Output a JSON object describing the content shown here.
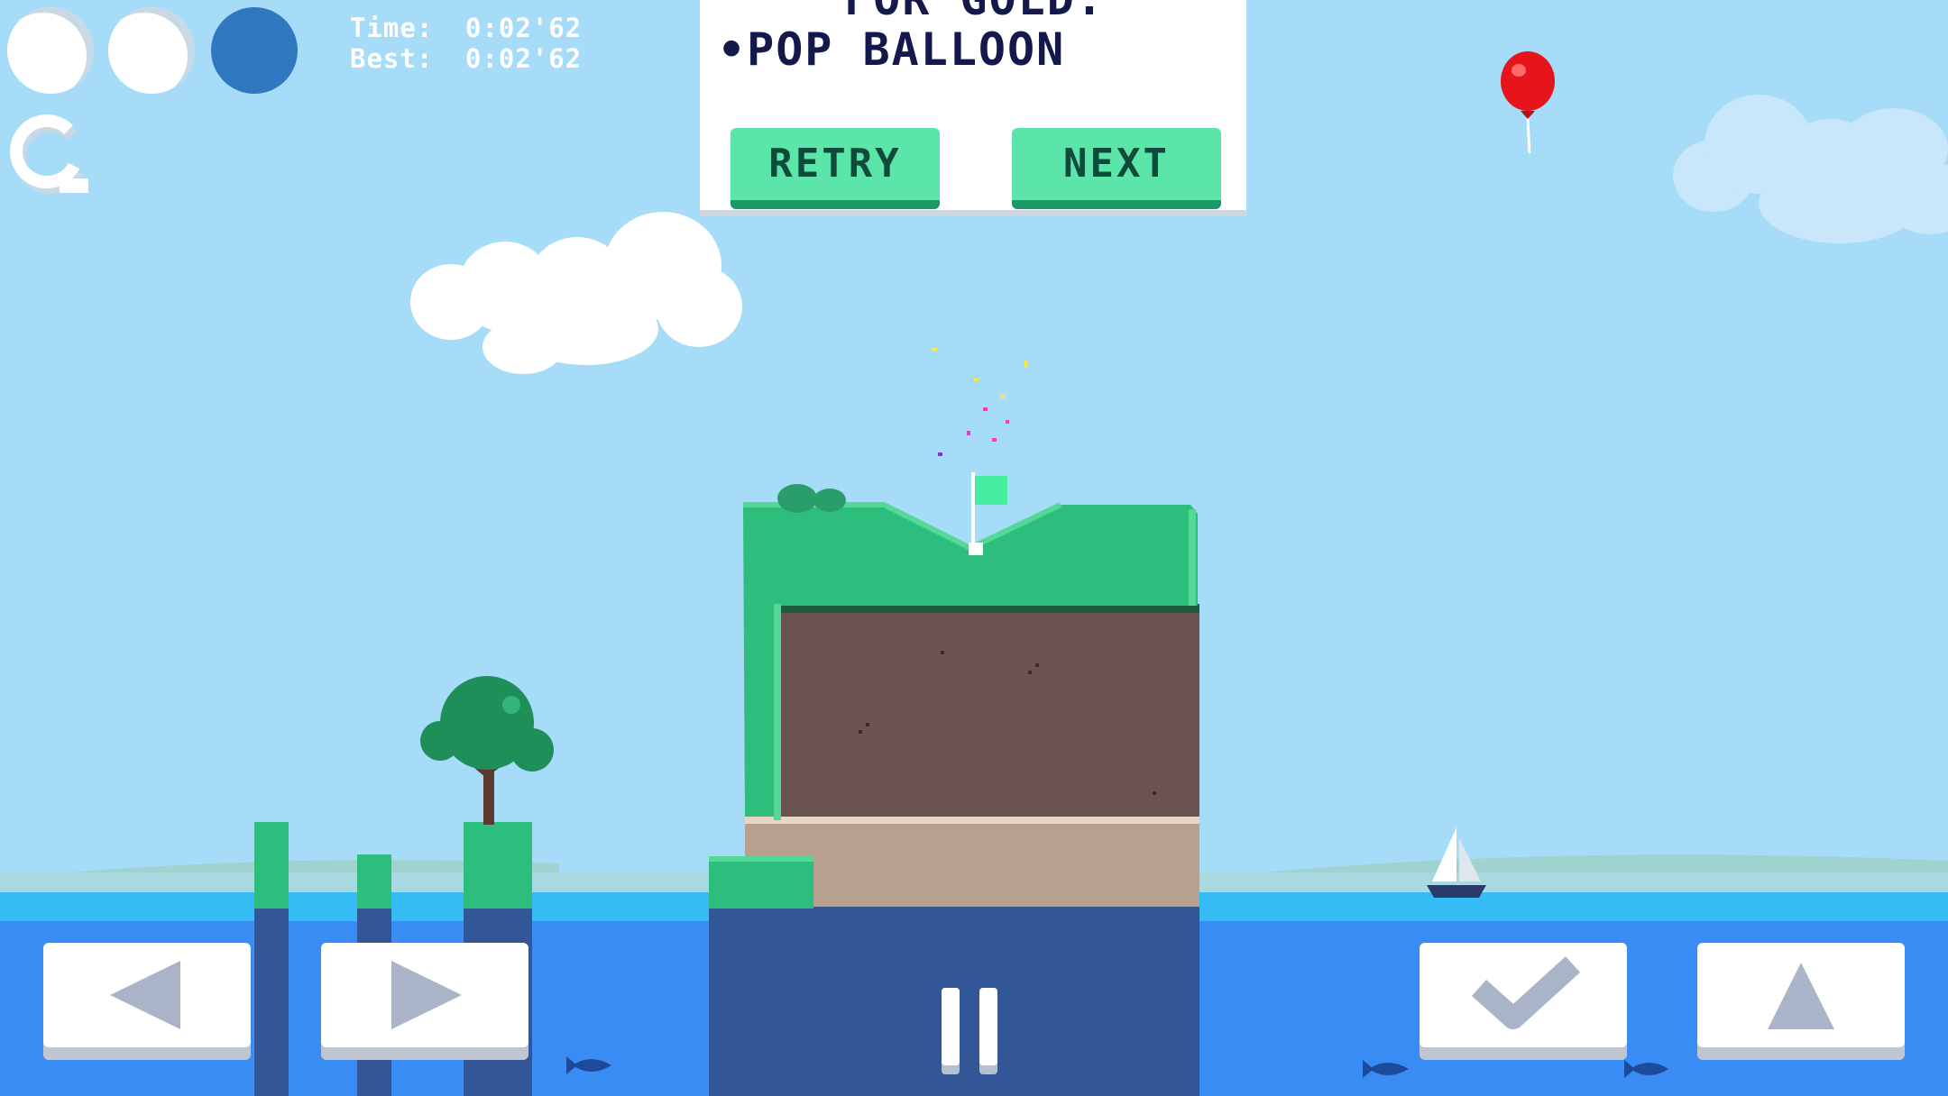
{
  "hud": {
    "shots": [
      {
        "state": "used"
      },
      {
        "state": "used"
      },
      {
        "state": "active"
      }
    ],
    "time_label": "Time:",
    "time_value": "0:02'62",
    "best_label": "Best:",
    "best_value": "0:02'62",
    "restart_icon": "restart-icon"
  },
  "goal_panel": {
    "heading": "FOR GOLD:",
    "objective": "•POP BALLOON",
    "retry_label": "RETRY",
    "next_label": "NEXT"
  },
  "controls": {
    "left_icon": "left-arrow-icon",
    "right_icon": "right-arrow-icon",
    "pause_icon": "pause-icon",
    "confirm_icon": "checkmark-icon",
    "jump_icon": "up-arrow-icon"
  },
  "colors": {
    "sky": "#a6dcf8",
    "water": "#3a8cf5",
    "grass": "#2dbd7d",
    "button_green": "#5be5a8",
    "balloon": "#e8141c",
    "active_ball": "#2f78c0",
    "panel_text": "#14184a"
  }
}
